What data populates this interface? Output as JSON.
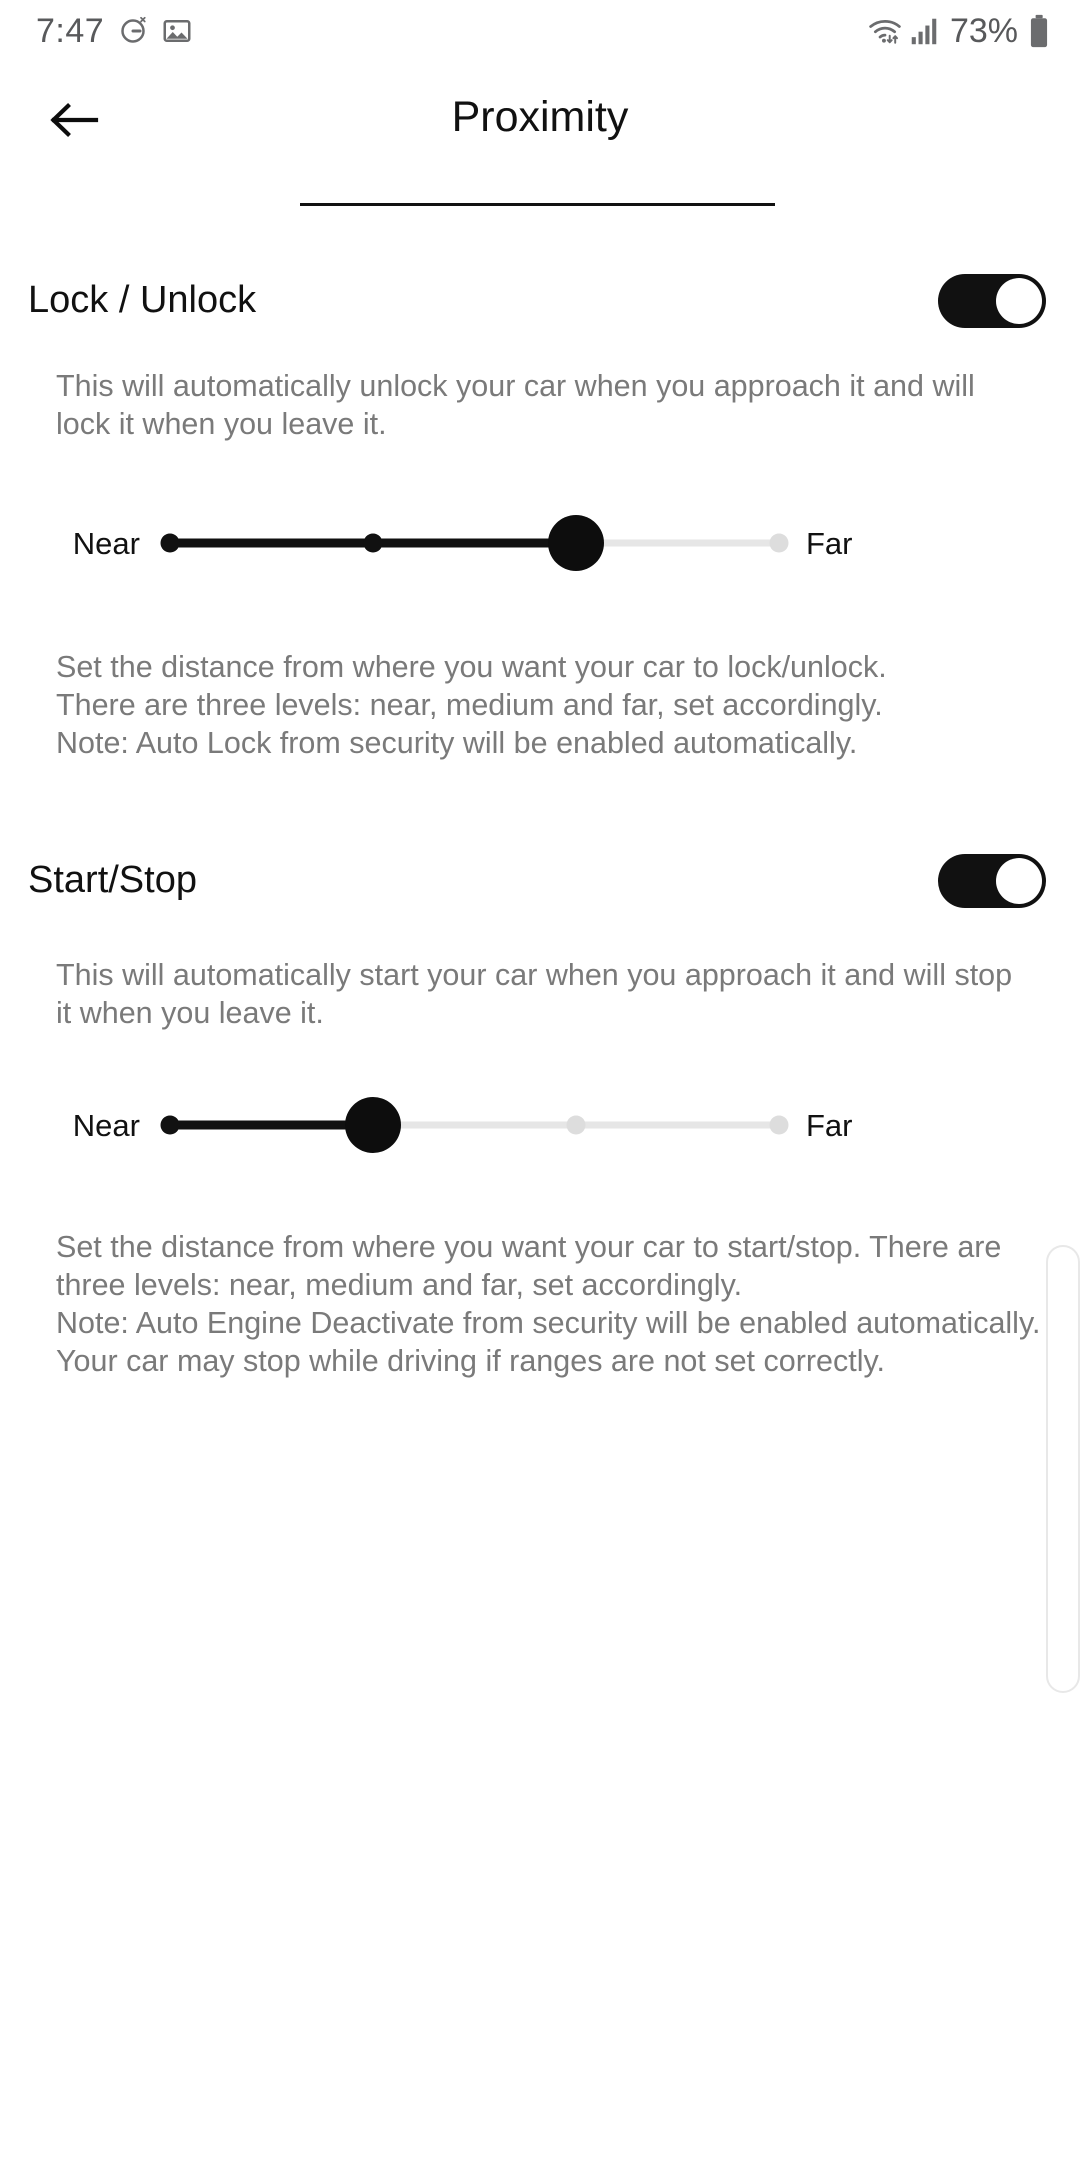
{
  "status_bar": {
    "time": "7:47",
    "battery_percent": "73%",
    "icons": [
      "alarm-off-icon",
      "gallery-icon",
      "wifi-icon",
      "cellular-signal-icon",
      "battery-icon"
    ]
  },
  "app_bar": {
    "back_icon": "back-arrow-icon",
    "title": "Proximity"
  },
  "sections": [
    {
      "title": "Lock / Unlock",
      "toggle_state": "on",
      "description_top": "This will automatically unlock your car when you approach it and will lock it when you leave it.",
      "slider": {
        "min_label": "Near",
        "max_label": "Far",
        "steps": 4,
        "value_index": 2
      },
      "description_bottom": "Set the distance from where you want your car to lock/unlock.\nThere are three levels: near, medium and far, set accordingly.\nNote: Auto Lock from security will be enabled automatically."
    },
    {
      "title": "Start/Stop",
      "toggle_state": "on",
      "description_top": "This will automatically start your car when you approach it and will stop it when you leave it.",
      "slider": {
        "min_label": "Near",
        "max_label": "Far",
        "steps": 4,
        "value_index": 1
      },
      "description_bottom": "Set the distance from where you want your car to start/stop. There are three levels: near, medium and far, set accordingly.\nNote: Auto Engine Deactivate from security will be enabled automatically. Your car may stop while driving if ranges are not set correctly."
    }
  ],
  "colors": {
    "accent": "#111111",
    "track_inactive": "#e6e6e6",
    "text_secondary": "#7a7a7a"
  }
}
